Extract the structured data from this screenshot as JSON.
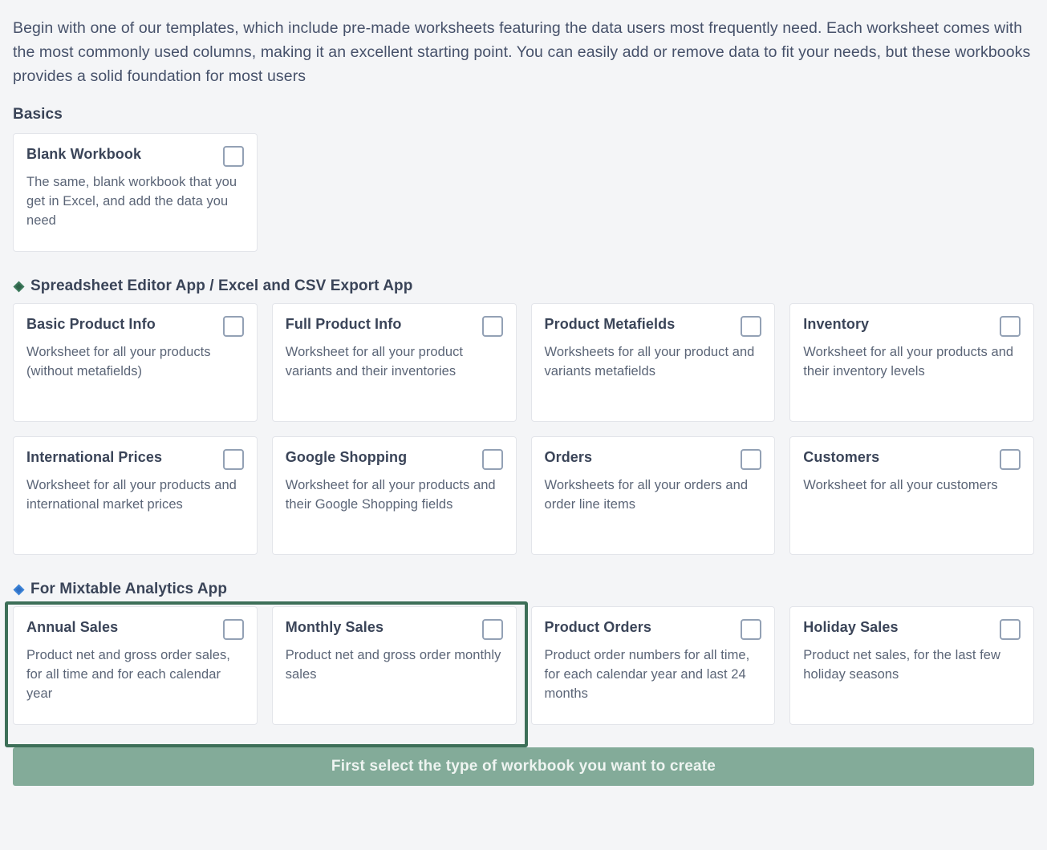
{
  "intro": {
    "text": "Begin with one of our templates, which include pre-made worksheets featuring the data users most frequently need. Each worksheet comes with the most commonly used columns, making it an excellent starting point. You can easily add or remove data to fit your needs, but these workbooks provides a solid foundation for most users"
  },
  "colors": {
    "background": "#f4f5f7",
    "card_background": "#ffffff",
    "card_border": "#e3e5ea",
    "title_text": "#3a4458",
    "body_text": "#5b6577",
    "checkbox_border": "#93a1b5",
    "green_diamond": "#3d7a5c",
    "blue_diamond": "#3b82d6",
    "selection_border": "#3d6f58",
    "footer_button": "#83ab99",
    "footer_button_text": "#eef4f1"
  },
  "sections": [
    {
      "id": "basics",
      "title": "Basics",
      "icon": null,
      "icon_color": null,
      "cards": [
        {
          "title": "Blank Workbook",
          "description": "The same, blank workbook that you get in Excel, and add the data you need",
          "checked": false
        }
      ]
    },
    {
      "id": "spreadsheet-editor",
      "title": "Spreadsheet Editor App / Excel and CSV Export App",
      "icon": "diamond-icon",
      "icon_color": "#3d7a5c",
      "cards": [
        {
          "title": "Basic Product Info",
          "description": "Worksheet for all your products (without metafields)",
          "checked": false
        },
        {
          "title": "Full Product Info",
          "description": "Worksheet for all your product variants and their inventories",
          "checked": false
        },
        {
          "title": "Product Metafields",
          "description": "Worksheets for all your product and variants metafields",
          "checked": false
        },
        {
          "title": "Inventory",
          "description": "Worksheet for all your products and their inventory levels",
          "checked": false
        },
        {
          "title": "International Prices",
          "description": "Worksheet for all your products and international market prices",
          "checked": false
        },
        {
          "title": "Google Shopping",
          "description": "Worksheet for all your products and their Google Shopping fields",
          "checked": false
        },
        {
          "title": "Orders",
          "description": "Worksheets for all your orders and order line items",
          "checked": false
        },
        {
          "title": "Customers",
          "description": "Worksheet for all your customers",
          "checked": false
        }
      ]
    },
    {
      "id": "mixtable-analytics",
      "title": "For Mixtable Analytics App",
      "icon": "diamond-icon",
      "icon_color": "#3b82d6",
      "cards": [
        {
          "title": "Annual Sales",
          "description": "Product net and gross order sales, for all time and for each calendar year",
          "checked": false
        },
        {
          "title": "Monthly Sales",
          "description": "Product net and gross order monthly sales",
          "checked": false
        },
        {
          "title": "Product Orders",
          "description": "Product order numbers for all time, for each calendar year and last 24 months",
          "checked": false
        },
        {
          "title": "Holiday Sales",
          "description": "Product net sales, for the last few holiday seasons",
          "checked": false
        }
      ]
    }
  ],
  "footer": {
    "button_label": "First select the type of workbook you want to create",
    "button_disabled": true
  }
}
